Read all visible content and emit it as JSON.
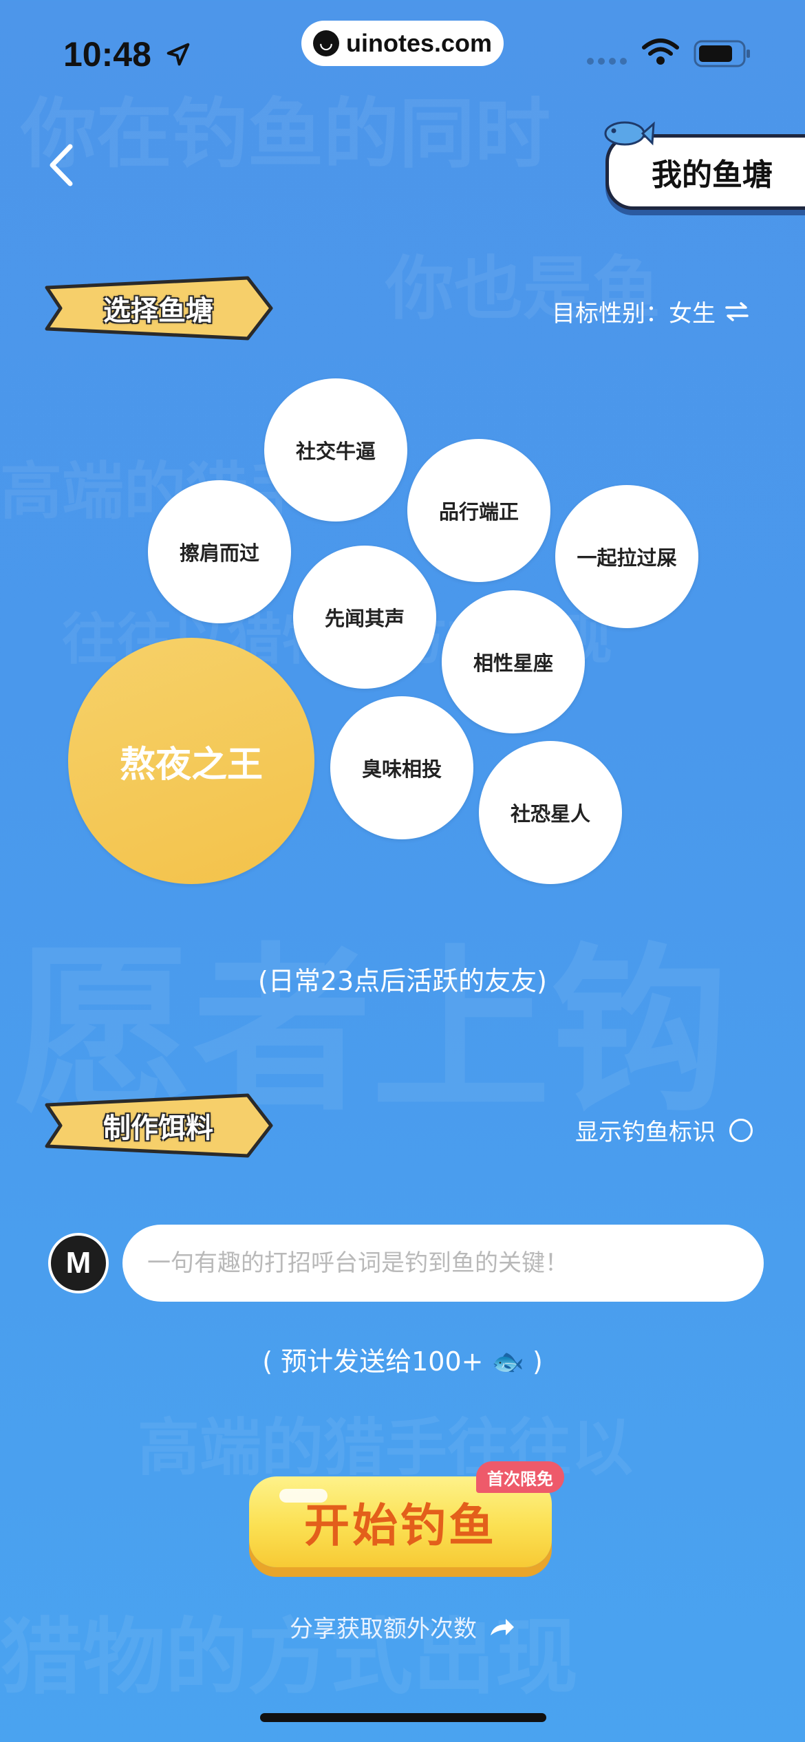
{
  "status_bar": {
    "time": "10:48",
    "url": "uinotes.com"
  },
  "watermark": {
    "lines": [
      "你在钓鱼的同时",
      "你也是鱼",
      "高端的猎手",
      "往往以猎物的方式出现",
      "愿者上钩",
      "高端的猎手往往以",
      "猎物的方式出现"
    ]
  },
  "header": {
    "my_pond_label": "我的鱼塘"
  },
  "select_pond": {
    "title": "选择鱼塘",
    "target_gender_label": "目标性别：女生",
    "ponds": [
      "社交牛逼",
      "品行端正",
      "擦肩而过",
      "一起拉过屎",
      "先闻其声",
      "相性星座",
      "熬夜之王",
      "臭味相投",
      "社恐星人"
    ],
    "selected": "熬夜之王",
    "selected_note": "(日常23点后活跃的友友)"
  },
  "make_bait": {
    "title": "制作饵料",
    "show_mark_label": "显示钓鱼标识",
    "input_placeholder": "一句有趣的打招呼台词是钓到鱼的关键！",
    "input_value": "",
    "send_note": "( 预计发送给100+ 🐟 )"
  },
  "start": {
    "label": "开始钓鱼",
    "badge": "首次限免"
  },
  "share": {
    "label": "分享获取额外次数"
  },
  "colors": {
    "background": "#4d96ea",
    "selected_bubble": "#f3c24a",
    "start_button": "#fbe052",
    "start_text": "#e35f1b",
    "badge": "#ee5a6a"
  }
}
